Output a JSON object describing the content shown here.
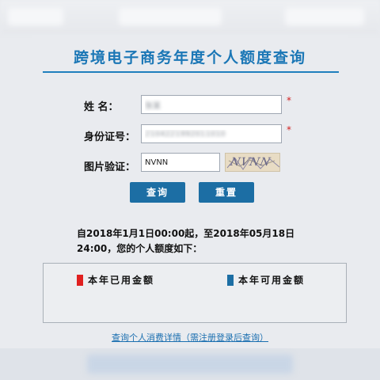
{
  "title": "跨境电子商务年度个人额度查询",
  "form": {
    "name_label": "姓    名：",
    "name_value": "张某",
    "id_label": "身份证号：",
    "id_value": "2104221992011010",
    "captcha_label": "图片验证：",
    "captcha_input": "NVNN",
    "captcha_image_text": "NVNN",
    "required_mark": "*"
  },
  "buttons": {
    "query": "查询",
    "reset": "重置"
  },
  "info": {
    "line1": "自2018年1月1日00:00起，至2018年05月18日",
    "line2": "24:00，您的个人额度如下："
  },
  "legend": {
    "used": "本年已用金额",
    "available": "本年可用金额",
    "used_color": "#e02020",
    "available_color": "#1c6ea4"
  },
  "link": "查询个人消费详情（需注册登录后查询）"
}
